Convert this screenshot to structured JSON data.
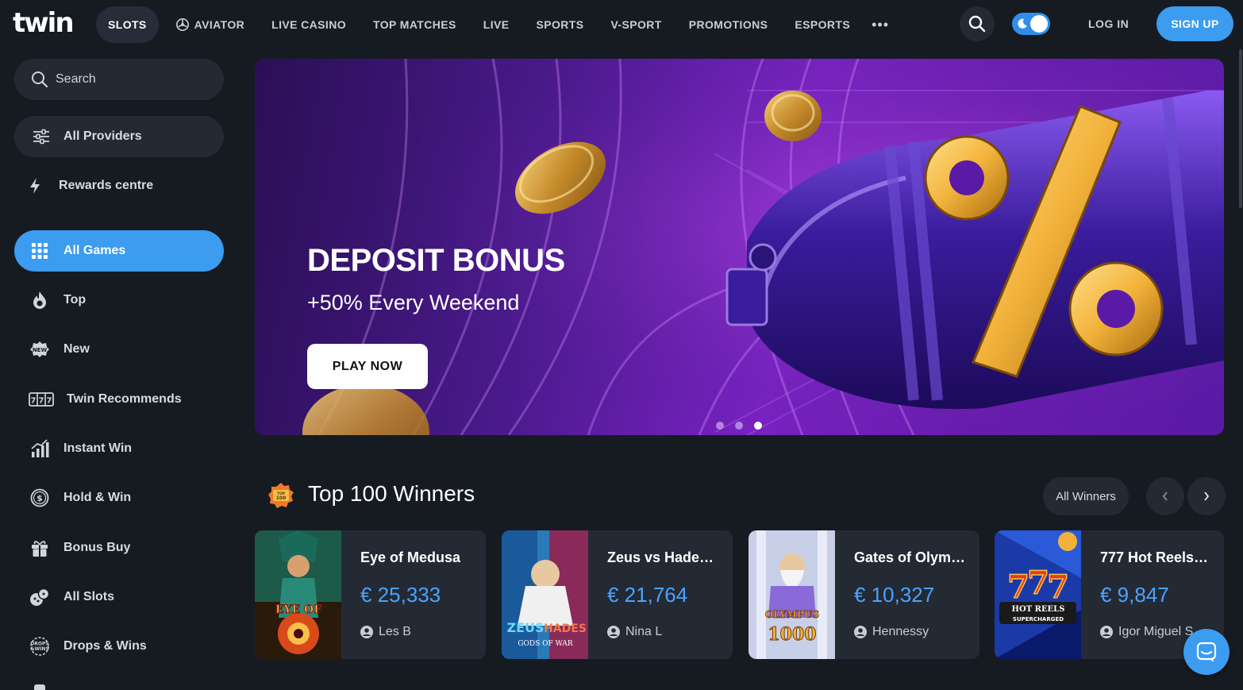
{
  "header": {
    "logo": "twin",
    "nav": [
      {
        "label": "SLOTS",
        "active": true
      },
      {
        "label": "AVIATOR",
        "icon": "aviator-icon"
      },
      {
        "label": "LIVE CASINO"
      },
      {
        "label": "TOP MATCHES"
      },
      {
        "label": "LIVE"
      },
      {
        "label": "SPORTS"
      },
      {
        "label": "V-SPORT"
      },
      {
        "label": "PROMOTIONS"
      },
      {
        "label": "ESPORTS"
      }
    ],
    "more": "•••",
    "login": "LOG IN",
    "signup": "SIGN UP"
  },
  "sidebar": {
    "search": "Search",
    "providers": "All Providers",
    "rewards": "Rewards centre",
    "items": [
      {
        "label": "All Games",
        "icon": "grid-icon",
        "active": true
      },
      {
        "label": "Top",
        "icon": "fire-icon"
      },
      {
        "label": "New",
        "icon": "new-badge-icon"
      },
      {
        "label": "Twin Recommends",
        "icon": "slot-reels-icon"
      },
      {
        "label": "Instant Win",
        "icon": "bar-chart-icon"
      },
      {
        "label": "Hold & Win",
        "icon": "coin-icon"
      },
      {
        "label": "Bonus Buy",
        "icon": "gift-icon"
      },
      {
        "label": "All Slots",
        "icon": "dice-icon"
      },
      {
        "label": "Drops & Wins",
        "icon": "drops-wins-icon"
      }
    ]
  },
  "banner": {
    "title": "DEPOSIT BONUS",
    "subtitle": "+50% Every Weekend",
    "cta": "PLAY NOW",
    "slides": 3,
    "active_slide": 3
  },
  "winners": {
    "title": "Top 100 Winners",
    "all_button": "All Winners",
    "items": [
      {
        "game": "Eye of Medusa",
        "amount": "€ 25,333",
        "user": "Les B"
      },
      {
        "game": "Zeus vs Hade…",
        "amount": "€ 21,764",
        "user": "Nina L"
      },
      {
        "game": "Gates of Olym…",
        "amount": "€ 10,327",
        "user": "Hennessy"
      },
      {
        "game": "777 Hot Reels…",
        "amount": "€ 9,847",
        "user": "Igor Miguel S"
      }
    ]
  },
  "colors": {
    "background": "#161b22",
    "panel": "#232a34",
    "accent": "#3b9cf0",
    "amount": "#4aa3ff"
  }
}
